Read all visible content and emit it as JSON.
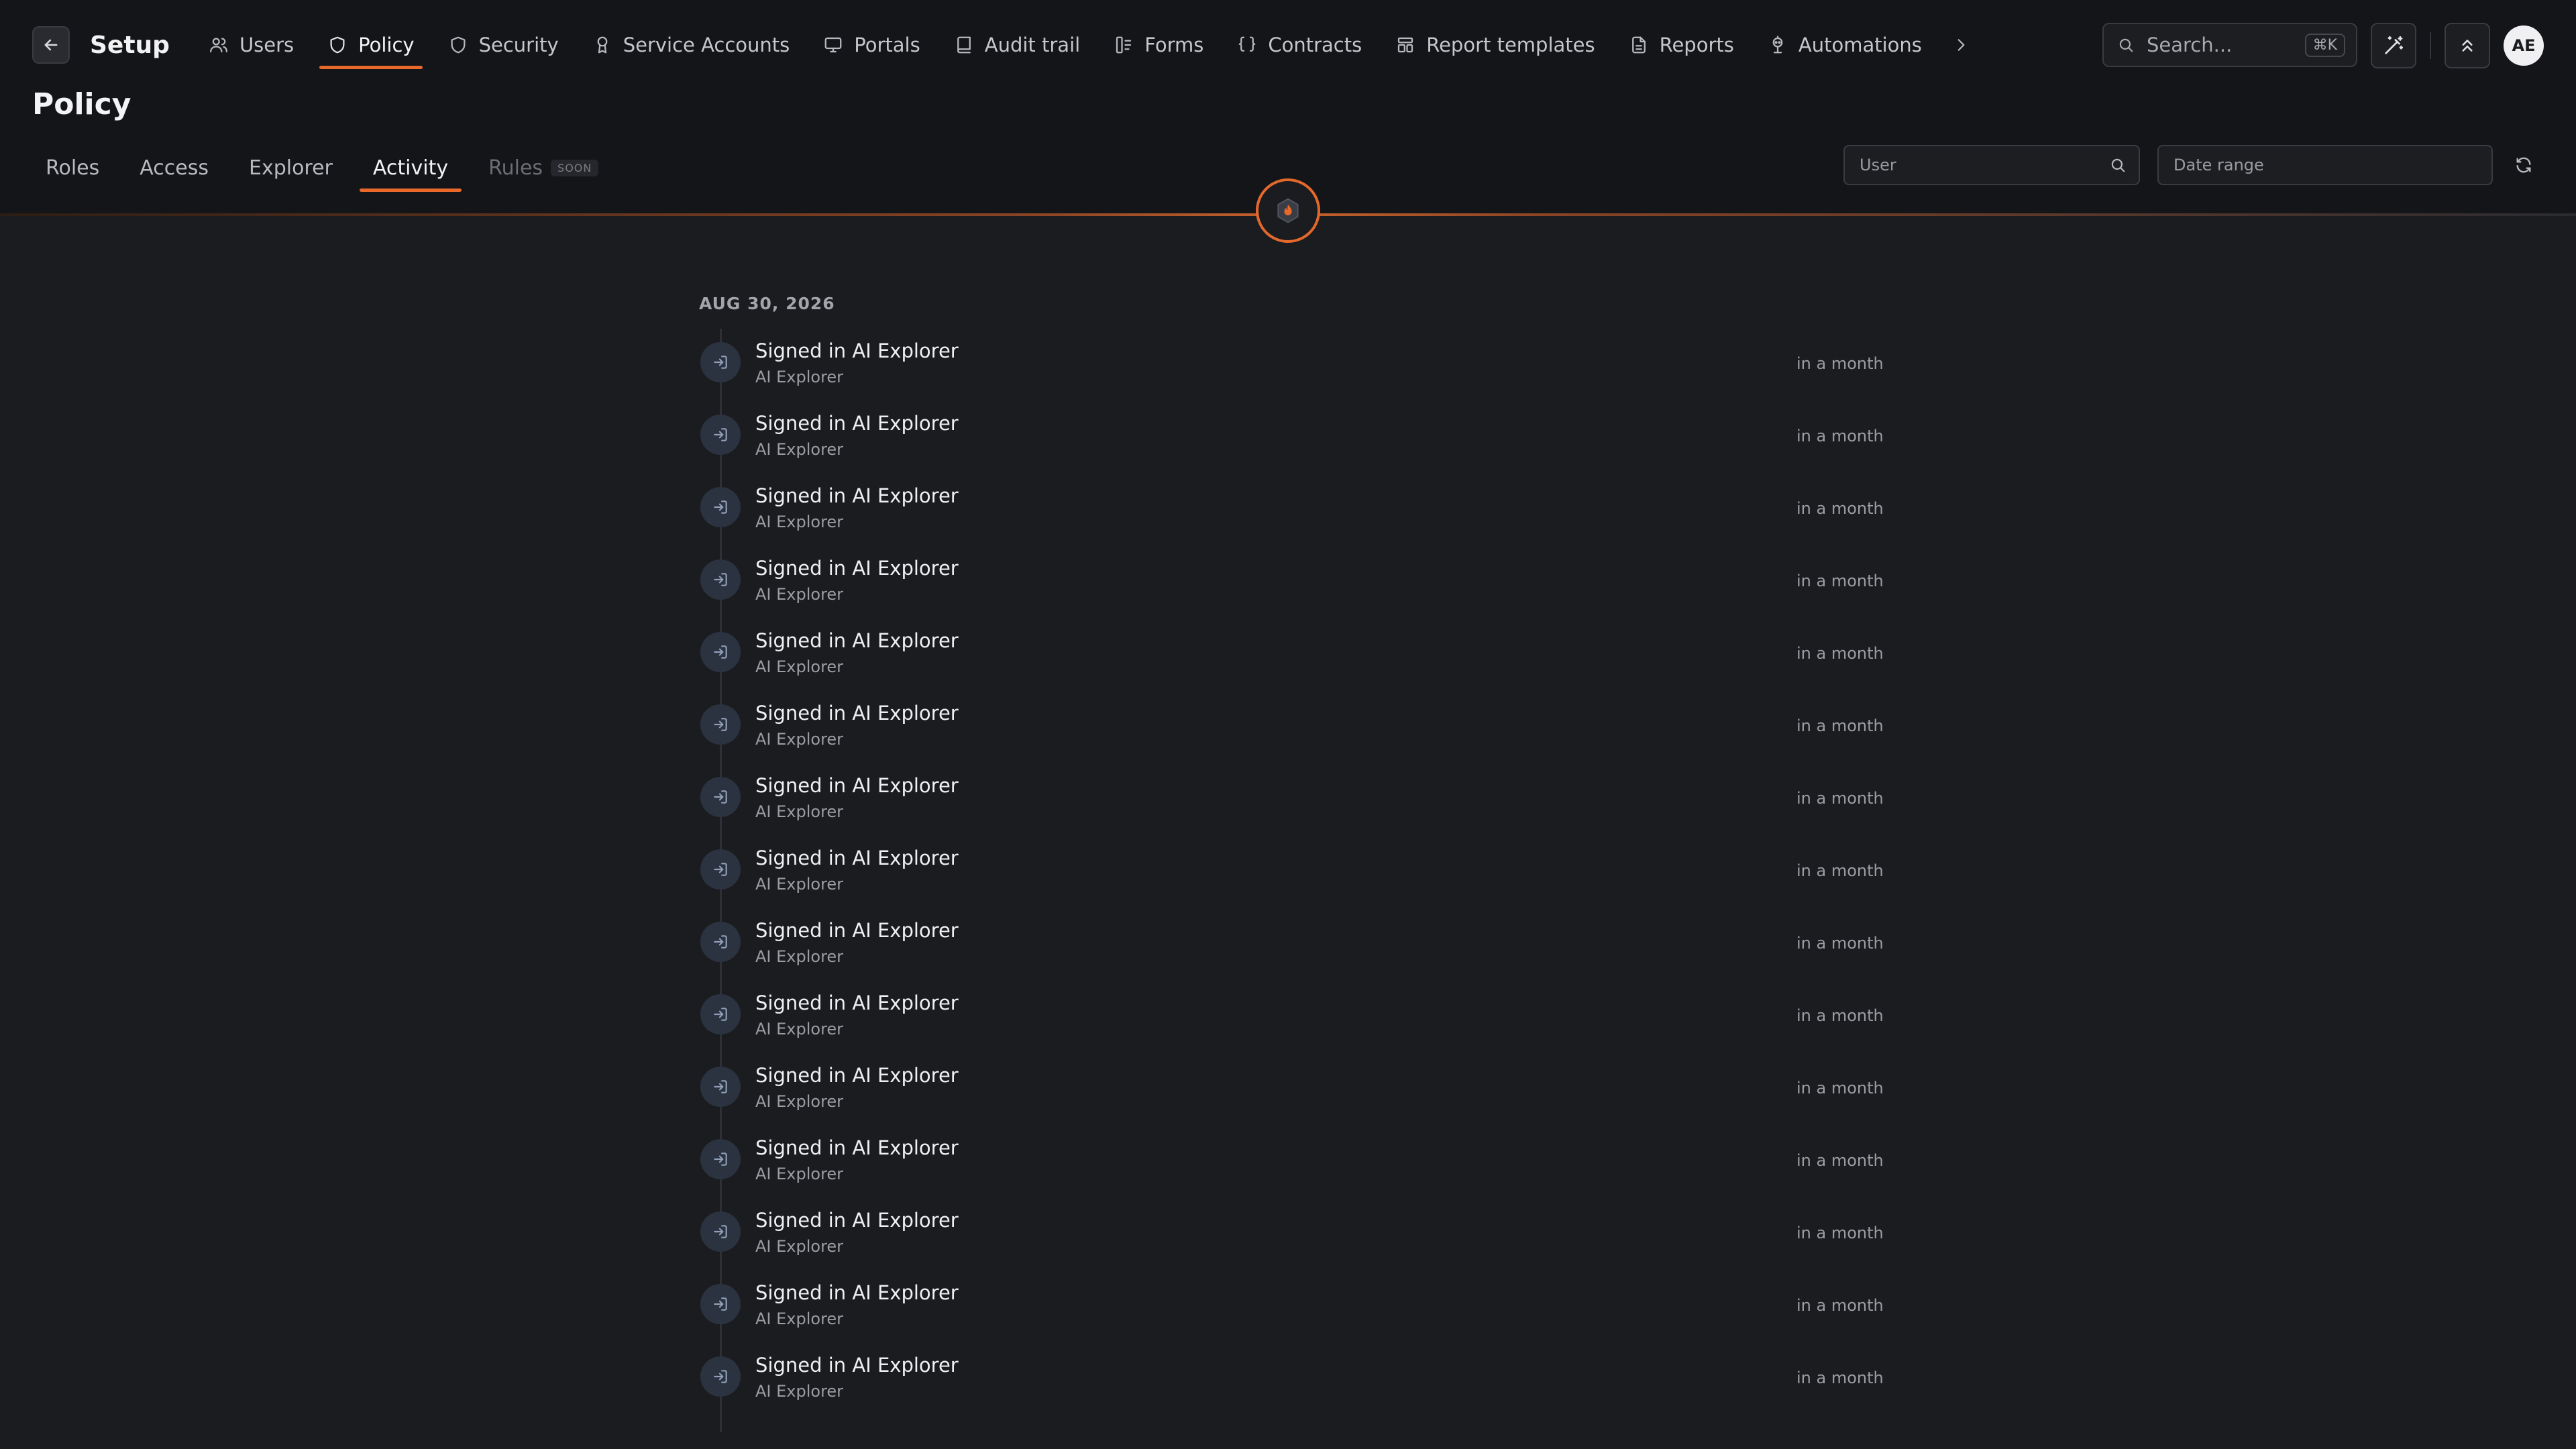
{
  "header": {
    "title": "Setup",
    "nav": [
      {
        "label": "Users",
        "icon": "users-icon"
      },
      {
        "label": "Policy",
        "icon": "shield-icon",
        "active": true
      },
      {
        "label": "Security",
        "icon": "shield-outline-icon"
      },
      {
        "label": "Service Accounts",
        "icon": "badge-icon"
      },
      {
        "label": "Portals",
        "icon": "monitor-icon"
      },
      {
        "label": "Audit trail",
        "icon": "book-icon"
      },
      {
        "label": "Forms",
        "icon": "form-icon"
      },
      {
        "label": "Contracts",
        "icon": "braces-icon"
      },
      {
        "label": "Report templates",
        "icon": "template-icon"
      },
      {
        "label": "Reports",
        "icon": "file-icon"
      },
      {
        "label": "Automations",
        "icon": "robot-icon"
      }
    ],
    "search": {
      "placeholder": "Search...",
      "shortcut": "⌘K"
    },
    "avatar_initials": "AE"
  },
  "page": {
    "title": "Policy",
    "tabs": [
      {
        "label": "Roles"
      },
      {
        "label": "Access"
      },
      {
        "label": "Explorer"
      },
      {
        "label": "Activity",
        "active": true
      },
      {
        "label": "Rules",
        "disabled": true,
        "badge": "SOON"
      }
    ],
    "filters": {
      "user_placeholder": "User",
      "date_placeholder": "Date range"
    }
  },
  "activity": {
    "date": "AUG 30, 2026",
    "entries": [
      {
        "title": "Signed in AI Explorer",
        "subtitle": "AI Explorer",
        "time": "in a month"
      },
      {
        "title": "Signed in AI Explorer",
        "subtitle": "AI Explorer",
        "time": "in a month"
      },
      {
        "title": "Signed in AI Explorer",
        "subtitle": "AI Explorer",
        "time": "in a month"
      },
      {
        "title": "Signed in AI Explorer",
        "subtitle": "AI Explorer",
        "time": "in a month"
      },
      {
        "title": "Signed in AI Explorer",
        "subtitle": "AI Explorer",
        "time": "in a month"
      },
      {
        "title": "Signed in AI Explorer",
        "subtitle": "AI Explorer",
        "time": "in a month"
      },
      {
        "title": "Signed in AI Explorer",
        "subtitle": "AI Explorer",
        "time": "in a month"
      },
      {
        "title": "Signed in AI Explorer",
        "subtitle": "AI Explorer",
        "time": "in a month"
      },
      {
        "title": "Signed in AI Explorer",
        "subtitle": "AI Explorer",
        "time": "in a month"
      },
      {
        "title": "Signed in AI Explorer",
        "subtitle": "AI Explorer",
        "time": "in a month"
      },
      {
        "title": "Signed in AI Explorer",
        "subtitle": "AI Explorer",
        "time": "in a month"
      },
      {
        "title": "Signed in AI Explorer",
        "subtitle": "AI Explorer",
        "time": "in a month"
      },
      {
        "title": "Signed in AI Explorer",
        "subtitle": "AI Explorer",
        "time": "in a month"
      },
      {
        "title": "Signed in AI Explorer",
        "subtitle": "AI Explorer",
        "time": "in a month"
      },
      {
        "title": "Signed in AI Explorer",
        "subtitle": "AI Explorer",
        "time": "in a month"
      }
    ]
  },
  "colors": {
    "accent": "#e8692a",
    "background": "#1b1c20",
    "header_background": "#141519"
  }
}
